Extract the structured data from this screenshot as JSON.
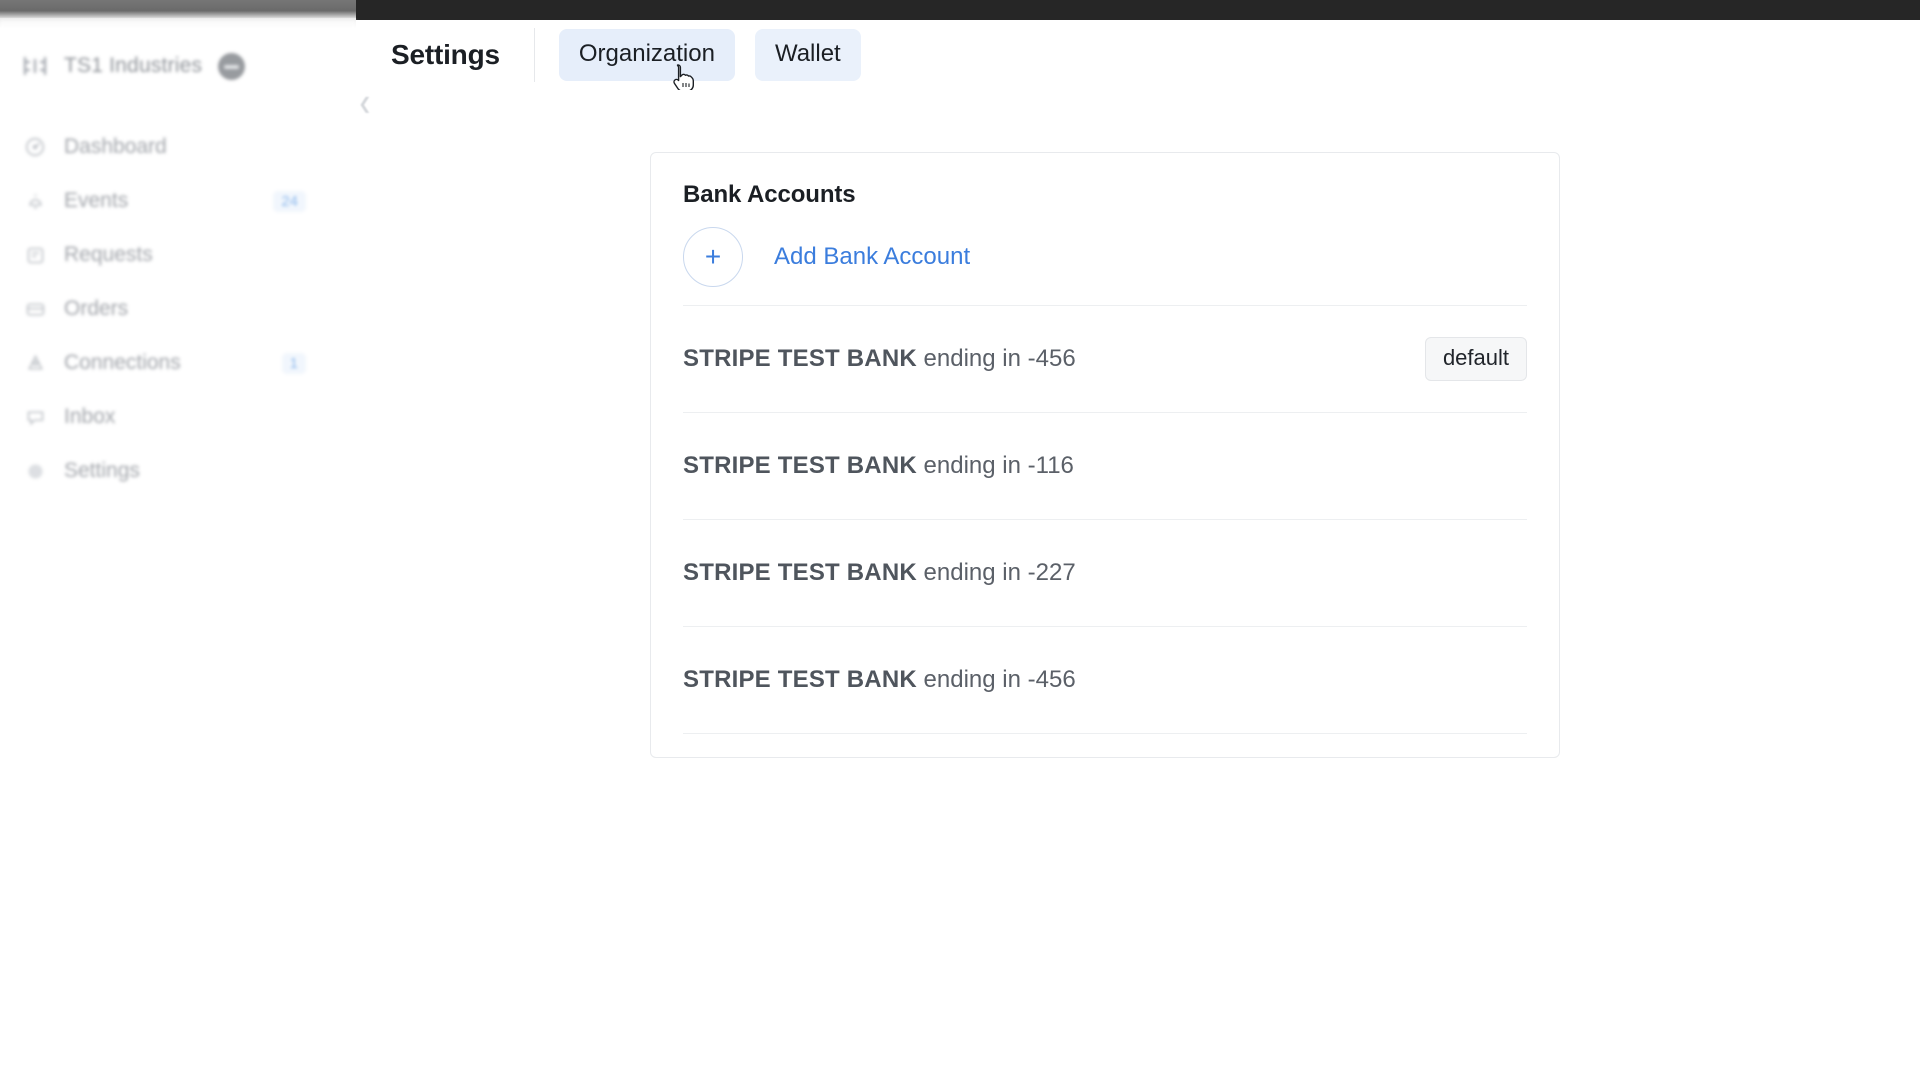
{
  "sidebar": {
    "brand": {
      "logo_icon": "m-logo-icon",
      "name": "TS1 Industries",
      "avatar_icon": "user-avatar-icon"
    },
    "items": [
      {
        "icon": "dashboard-icon",
        "label": "Dashboard",
        "badge": ""
      },
      {
        "icon": "bell-icon",
        "label": "Events",
        "badge": "24"
      },
      {
        "icon": "requests-icon",
        "label": "Requests",
        "badge": ""
      },
      {
        "icon": "orders-icon",
        "label": "Orders",
        "badge": ""
      },
      {
        "icon": "connections-icon",
        "label": "Connections",
        "badge": "1"
      },
      {
        "icon": "inbox-icon",
        "label": "Inbox",
        "badge": ""
      },
      {
        "icon": "settings-icon",
        "label": "Settings",
        "badge": ""
      }
    ],
    "collapse_icon": "chevron-left-icon"
  },
  "header": {
    "title": "Settings",
    "tabs": [
      {
        "label": "Organization",
        "hovered": true
      },
      {
        "label": "Wallet",
        "hovered": false
      }
    ]
  },
  "main": {
    "card": {
      "title": "Bank Accounts",
      "add_button": {
        "icon": "plus-icon",
        "label": "Add Bank Account"
      },
      "accounts": [
        {
          "bank": "STRIPE TEST BANK",
          "detail": " ending in -456",
          "badge": "default"
        },
        {
          "bank": "STRIPE TEST BANK",
          "detail": " ending in -116",
          "badge": ""
        },
        {
          "bank": "STRIPE TEST BANK",
          "detail": " ending in -227",
          "badge": ""
        },
        {
          "bank": "STRIPE TEST BANK",
          "detail": " ending in -456",
          "badge": ""
        }
      ]
    }
  },
  "colors": {
    "accent_blue": "#3b7ddd",
    "tab_background": "#eaf1fb",
    "badge_blue": "#4a90e2",
    "text_dark": "#1b1f24",
    "text_muted": "#5b6068",
    "border": "#e8eaed"
  },
  "cursor": {
    "icon": "pointing-hand-cursor"
  }
}
